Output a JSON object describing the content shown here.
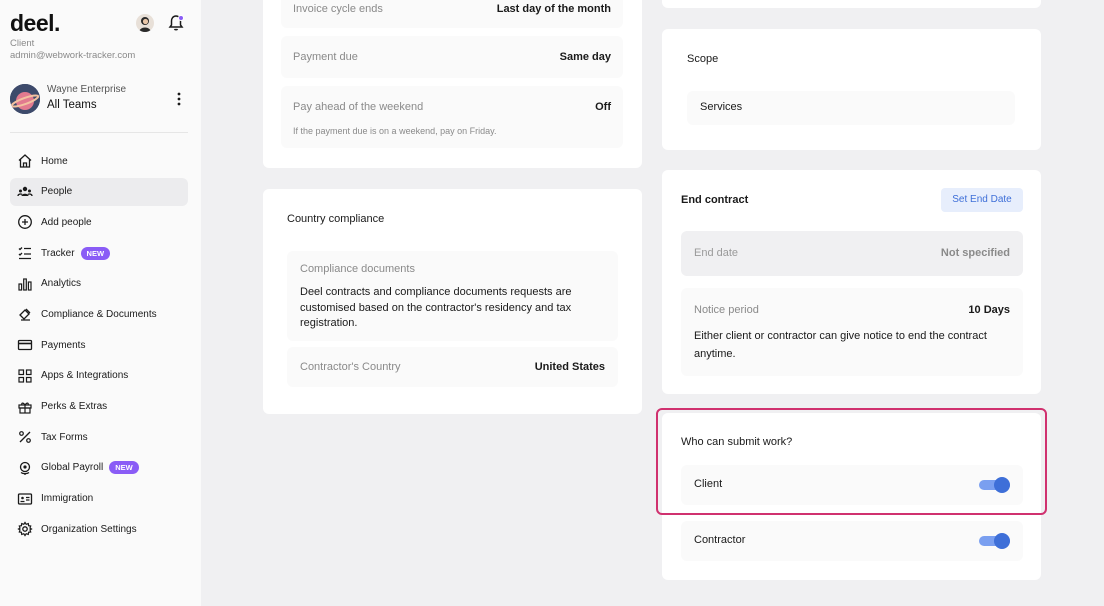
{
  "sidebar": {
    "logo": "deel.",
    "role": "Client",
    "email": "admin@webwork-tracker.com",
    "org_name": "Wayne Enterprise",
    "org_team": "All Teams",
    "nav": [
      {
        "label": "Home",
        "icon": "home-icon"
      },
      {
        "label": "People",
        "icon": "people-icon",
        "active": true
      },
      {
        "label": "Add people",
        "icon": "plus-circle-icon"
      },
      {
        "label": "Tracker",
        "icon": "tracker-icon",
        "badge": "NEW"
      },
      {
        "label": "Analytics",
        "icon": "bar-chart-icon"
      },
      {
        "label": "Compliance & Documents",
        "icon": "stamp-icon"
      },
      {
        "label": "Payments",
        "icon": "credit-card-icon"
      },
      {
        "label": "Apps & Integrations",
        "icon": "apps-icon"
      },
      {
        "label": "Perks & Extras",
        "icon": "gift-icon"
      },
      {
        "label": "Tax Forms",
        "icon": "percent-icon"
      },
      {
        "label": "Global Payroll",
        "icon": "globe-icon",
        "badge": "NEW"
      },
      {
        "label": "Immigration",
        "icon": "id-card-icon"
      },
      {
        "label": "Organization Settings",
        "icon": "gear-icon"
      }
    ]
  },
  "payment_card": {
    "invoice_cycle_label": "Invoice cycle ends",
    "invoice_cycle_value": "Last day of the month",
    "payment_due_label": "Payment due",
    "payment_due_value": "Same day",
    "pay_ahead_label": "Pay ahead of the weekend",
    "pay_ahead_value": "Off",
    "pay_ahead_note": "If the payment due is on a weekend, pay on Friday."
  },
  "compliance_card": {
    "title": "Country compliance",
    "docs_label": "Compliance documents",
    "docs_text": "Deel contracts and compliance documents requests are customised based on the contractor's residency and tax registration.",
    "country_label": "Contractor's Country",
    "country_value": "United States"
  },
  "scope_card": {
    "title": "Scope",
    "value": "Services"
  },
  "end_contract_card": {
    "title": "End contract",
    "button": "Set End Date",
    "end_date_label": "End date",
    "end_date_value": "Not specified",
    "notice_label": "Notice period",
    "notice_value": "10 Days",
    "notice_text": "Either client or contractor can give notice to end the contract anytime."
  },
  "submit_card": {
    "title": "Who can submit work?",
    "client_label": "Client",
    "client_on": true,
    "contractor_label": "Contractor",
    "contractor_on": true
  },
  "colors": {
    "accent": "#3e6fd8",
    "badge": "#8a5cf6",
    "highlight": "#d0316f"
  }
}
